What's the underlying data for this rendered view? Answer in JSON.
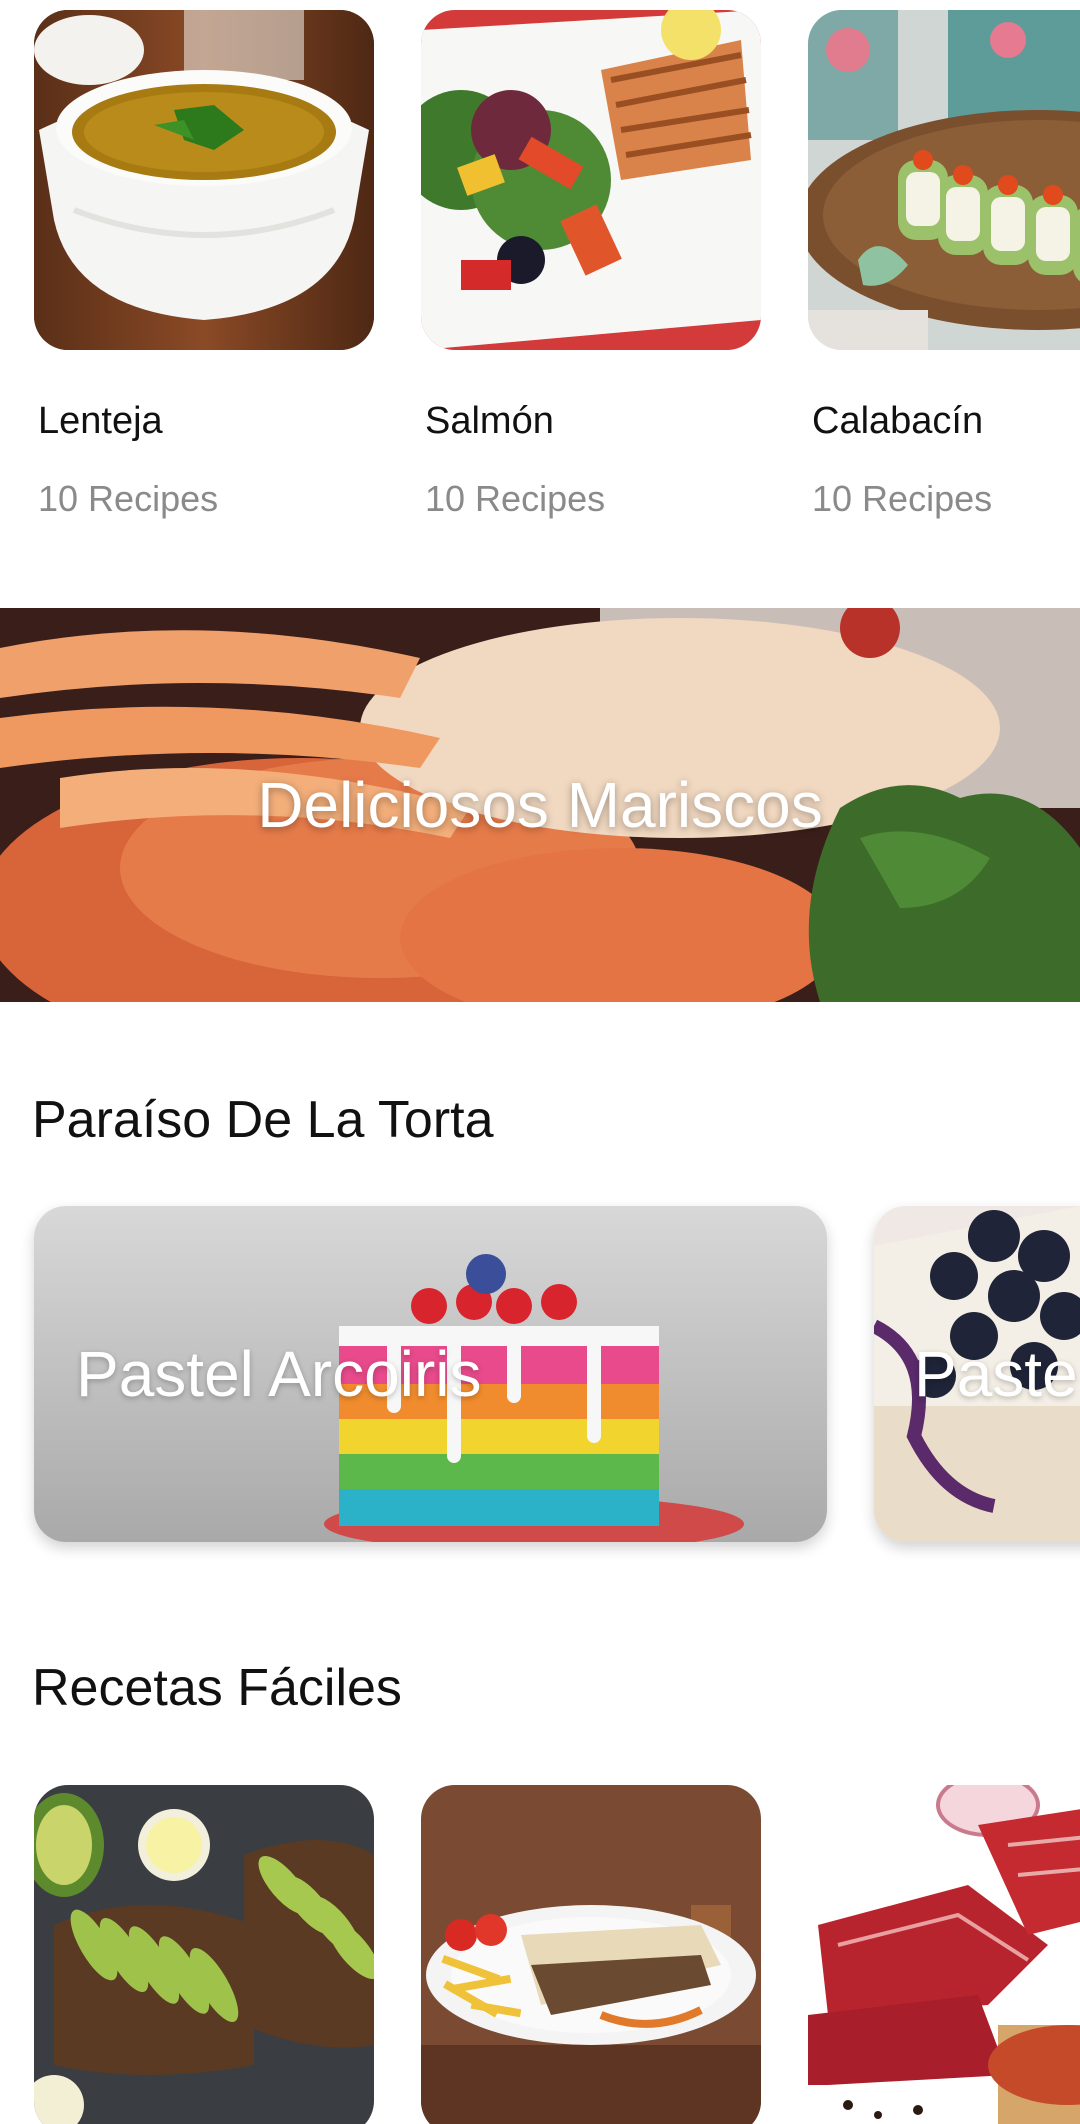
{
  "categories": [
    {
      "name": "Lenteja",
      "count": "10 Recipes",
      "image": "lentil-soup-bowl"
    },
    {
      "name": "Salmón",
      "count": "10 Recipes",
      "image": "grilled-salmon-salad"
    },
    {
      "name": "Calabacín",
      "count": "10 Recipes",
      "image": "zucchini-sushi-rolls"
    }
  ],
  "banner": {
    "title": "Deliciosos Mariscos",
    "image": "lobster-seafood"
  },
  "cake_section": {
    "title": "Paraíso De La Torta",
    "cards": [
      {
        "label": "Pastel Arcoiris",
        "image": "rainbow-cake"
      },
      {
        "label": "Paste",
        "image": "blueberry-cheesecake"
      }
    ]
  },
  "easy_section": {
    "title": "Recetas Fáciles",
    "cards": [
      {
        "image": "avocado-toast"
      },
      {
        "image": "wrap-and-fries-plate"
      },
      {
        "image": "raw-beef-cuts"
      }
    ]
  }
}
